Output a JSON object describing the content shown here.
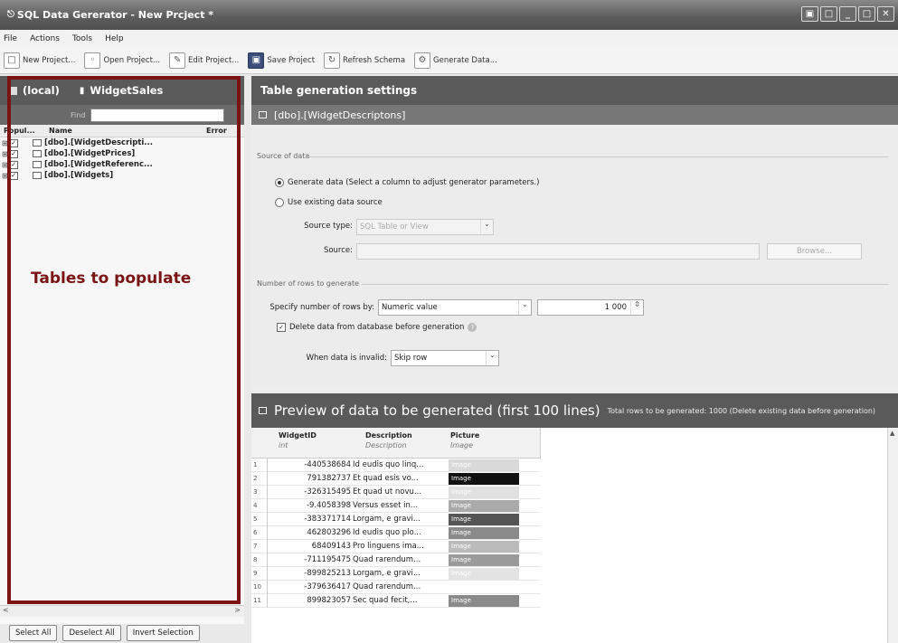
{
  "window": {
    "title": "SQL Data Gererator - New Prcject *",
    "controls": [
      "▣",
      "□",
      "_",
      "□",
      "✕"
    ]
  },
  "menu": [
    "File",
    "Actions",
    "Tools",
    "Help"
  ],
  "toolbar": [
    {
      "label": "New Project...",
      "icon": "new-project-icon"
    },
    {
      "label": "Open Project...",
      "icon": "open-project-icon"
    },
    {
      "label": "Edit Project...",
      "icon": "edit-project-icon"
    },
    {
      "label": "Save Project",
      "icon": "save-icon"
    },
    {
      "label": "Refresh Schema",
      "icon": "refresh-icon"
    },
    {
      "label": "Generate Data...",
      "icon": "generate-icon"
    }
  ],
  "left": {
    "server": "(local)",
    "database": "WidgetSales",
    "find_label": "Find",
    "find_value": "",
    "columns": {
      "populate": "Popul...",
      "name": "Name",
      "error": "Error"
    },
    "tables": [
      {
        "name": "[dbo].[WidgetDescripti...",
        "checked": true
      },
      {
        "name": "[dbo].[WidgetPrices]",
        "checked": true
      },
      {
        "name": "[dbo].[WidgetReferenc...",
        "checked": true
      },
      {
        "name": "[dbo].[Widgets]",
        "checked": true
      }
    ],
    "buttons": {
      "select_all": "Select All",
      "deselect_all": "Deselect All",
      "invert": "Invert Selection"
    }
  },
  "annotation": "Tables to populate",
  "right": {
    "header": "Table generation settings",
    "table_name": "[dbo].[WidgetDescriptons]",
    "source_section": "Source of data",
    "generate_radio": "Generate data (Select a column to adjust generator parameters.)",
    "existing_radio": "Use existing data source",
    "source_type_label": "Source type:",
    "source_type_value": "SQL Table or View",
    "source_label": "Source:",
    "source_value": "",
    "browse_label": "Browse...",
    "rows_section": "Number of rows to generate",
    "specify_label": "Specify number of rows by:",
    "specify_value": "Numeric value",
    "rows_value": "1 000",
    "delete_label": "Delete data from database before generation",
    "invalid_label": "When data is invalid:",
    "invalid_value": "Skip row"
  },
  "preview": {
    "title": "Preview of data to be generated (first 100 lines)",
    "note": "Total rows to be generated: 1000 (Delete existing data before generation)",
    "columns": [
      {
        "name": "WidgetID",
        "type": "int"
      },
      {
        "name": "Description",
        "type": "Description"
      },
      {
        "name": "Picture",
        "type": "Image"
      }
    ],
    "rows": [
      {
        "n": "1",
        "id": "-440538684",
        "desc": "Id eudis quo linq...",
        "img": "Image",
        "shade": "#d9d9d9"
      },
      {
        "n": "2",
        "id": "791382737",
        "desc": "Et quad esis vo...",
        "img": "Image",
        "shade": "#111111"
      },
      {
        "n": "3",
        "id": "-326315495",
        "desc": "Et quad ut novu...",
        "img": "Image",
        "shade": "#e0e0e0"
      },
      {
        "n": "4",
        "id": "-9.4058398",
        "desc": "Versus esset in...",
        "img": "Image",
        "shade": "#aaaaaa"
      },
      {
        "n": "5",
        "id": "-383371714",
        "desc": "Lorgam, e gravi...",
        "img": "Image",
        "shade": "#555555"
      },
      {
        "n": "6",
        "id": "462803296",
        "desc": "Id eudis quo plo...",
        "img": "Image",
        "shade": "#8a8a8a"
      },
      {
        "n": "7",
        "id": "68409143",
        "desc": "Pro linguens ima...",
        "img": "Image",
        "shade": "#bbbbbb"
      },
      {
        "n": "8",
        "id": "-711195475",
        "desc": "Quad rarendum...",
        "img": "Image",
        "shade": "#9a9a9a"
      },
      {
        "n": "9",
        "id": "-899825213",
        "desc": "Lorgam, e gravi...",
        "img": "Image",
        "shade": "#e3e3e3"
      },
      {
        "n": "10",
        "id": "-379636417",
        "desc": "Quad rarendum...",
        "img": "",
        "shade": "#ffffff"
      },
      {
        "n": "11",
        "id": "899823057",
        "desc": "Sec quad fecit,...",
        "img": "Image",
        "shade": "#8a8a8a"
      }
    ]
  }
}
